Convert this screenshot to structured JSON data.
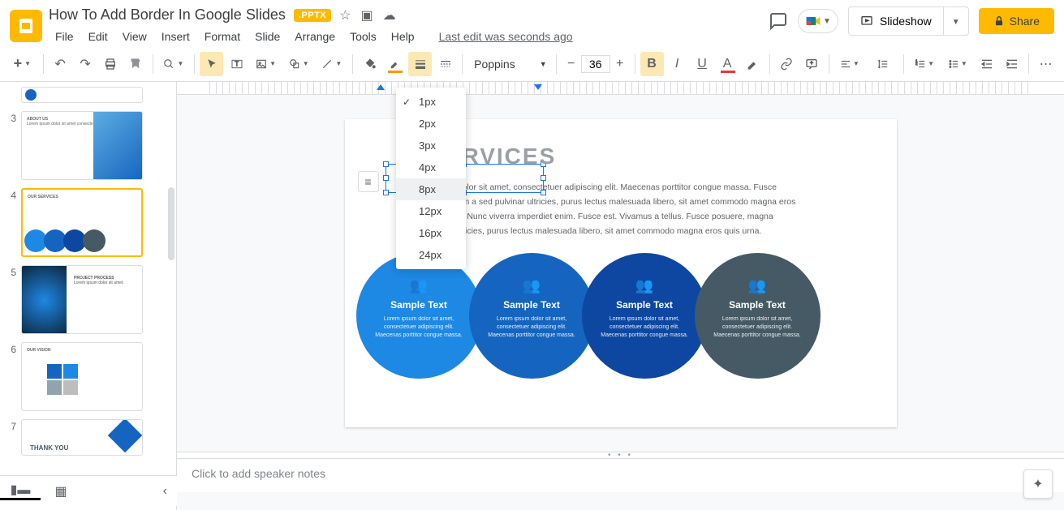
{
  "doc": {
    "title": "How To Add Border In Google Slides",
    "badge": ".PPTX",
    "last_edit": "Last edit was seconds ago"
  },
  "menus": [
    "File",
    "Edit",
    "View",
    "Insert",
    "Format",
    "Slide",
    "Arrange",
    "Tools",
    "Help"
  ],
  "header_buttons": {
    "slideshow": "Slideshow",
    "share": "Share"
  },
  "toolbar": {
    "font": "Poppins",
    "font_size": "36"
  },
  "border_weight_options": [
    "1px",
    "2px",
    "3px",
    "4px",
    "8px",
    "12px",
    "16px",
    "24px"
  ],
  "border_weight_selected": "1px",
  "border_weight_highlighted": "8px",
  "thumbnails": [
    {
      "num": "",
      "label": ""
    },
    {
      "num": "3",
      "label": "ABOUT US"
    },
    {
      "num": "4",
      "label": "OUR SERVICES"
    },
    {
      "num": "5",
      "label": "PROJECT PROCESS"
    },
    {
      "num": "6",
      "label": "OUR VISION"
    },
    {
      "num": "7",
      "label": "THANK YOU"
    }
  ],
  "slide": {
    "title_visible": "RVICES",
    "title_full": "OUR SERVICES",
    "body_l1": "olor sit amet, consectetuer adipiscing elit. Maecenas porttitor congue massa. Fusce",
    "body_l2": "m a sed pulvinar ultricies, purus lectus malesuada libero, sit amet commodo magna eros",
    "body_l3": ". Nunc viverra imperdiet enim. Fusce est. Vivamus a tellus. Fusce posuere, magna",
    "body_l4": "ricies, purus lectus malesuada libero, sit amet commodo magna eros quis urna.",
    "circles": [
      {
        "title": "Sample Text",
        "desc": "Lorem ipsum dolor sit amet, consectetuer adipiscing elit. Maecenas porttitor congue massa."
      },
      {
        "title": "Sample Text",
        "desc": "Lorem ipsum dolor sit amet, consectetuer adipiscing elit. Maecenas porttitor congue massa."
      },
      {
        "title": "Sample Text",
        "desc": "Lorem ipsum dolor sit amet, consectetuer adipiscing elit. Maecenas porttitor congue massa."
      },
      {
        "title": "Sample Text",
        "desc": "Lorem ipsum dolor sit amet, consectetuer adipiscing elit. Maecenas porttitor congue massa."
      }
    ]
  },
  "notes_placeholder": "Click to add speaker notes"
}
